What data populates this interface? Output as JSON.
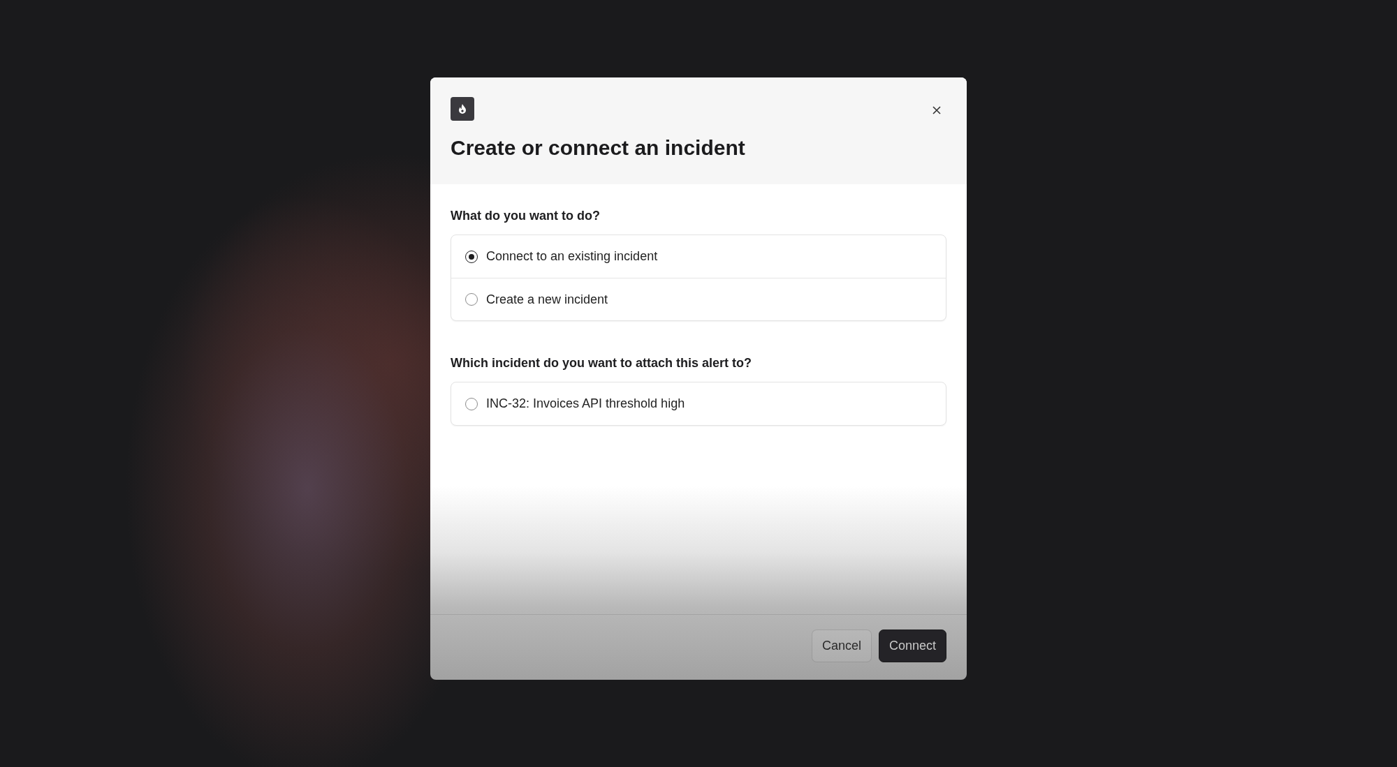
{
  "dialog": {
    "title": "Create or connect an incident",
    "questions": [
      {
        "label": "What do you want to do?",
        "options": [
          {
            "label": "Connect to an existing incident",
            "selected": true
          },
          {
            "label": "Create a new incident",
            "selected": false
          }
        ]
      },
      {
        "label": "Which incident do you want to attach this alert to?",
        "options": [
          {
            "label": "INC-32: Invoices API threshold high",
            "selected": false
          }
        ]
      }
    ],
    "buttons": [
      {
        "label": "Cancel",
        "kind": "secondary"
      },
      {
        "label": "Connect",
        "kind": "primary"
      }
    ]
  }
}
